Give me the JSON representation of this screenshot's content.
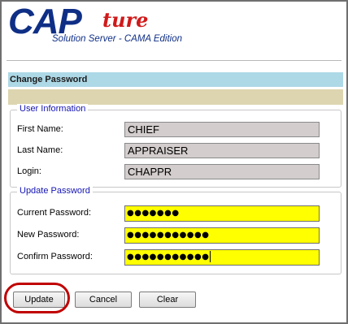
{
  "logo": {
    "cap": "CAP",
    "ture": "ture",
    "subtitle": "Solution Server - CAMA Edition"
  },
  "page_title": "Change Password",
  "message": "",
  "user_info": {
    "legend": "User Information",
    "first_name_label": "First Name:",
    "first_name_value": "CHIEF",
    "last_name_label": "Last Name:",
    "last_name_value": "APPRAISER",
    "login_label": "Login:",
    "login_value": "CHAPPR"
  },
  "update_password": {
    "legend": "Update Password",
    "current_label": "Current Password:",
    "current_value": "●●●●●●●",
    "new_label": "New Password:",
    "new_value": "●●●●●●●●●●●",
    "confirm_label": "Confirm Password:",
    "confirm_value": "●●●●●●●●●●●"
  },
  "buttons": {
    "update": "Update",
    "cancel": "Cancel",
    "clear": "Clear"
  },
  "colors": {
    "header_bar": "#add8e6",
    "message_bar": "#ddd5b0",
    "password_field": "#ffff00",
    "highlight": "#c00000"
  }
}
